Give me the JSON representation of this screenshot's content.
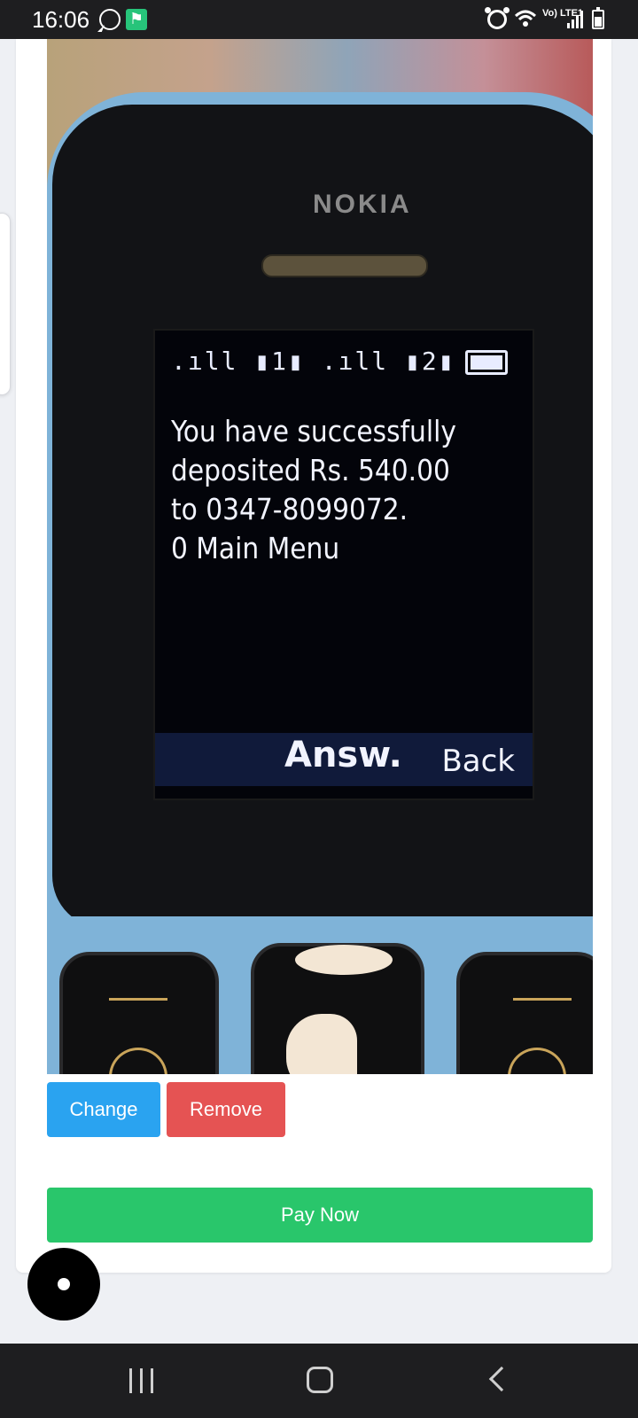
{
  "status_bar": {
    "time": "16:06",
    "network_label": "Vo) LTE1",
    "icons": [
      "whatsapp-icon",
      "fitness-icon",
      "alarm-icon",
      "wifi-icon",
      "signal-icon",
      "battery-icon"
    ]
  },
  "photo": {
    "brand": "NOKIA",
    "screen_indicators": ".ıll ▮1▮ .ıll ▮2▮ ▬",
    "message_lines": [
      "You have successfully",
      "deposited Rs. 540.00",
      "to 0347-8099072.",
      "0 Main Menu"
    ],
    "softkey_center": "Answ.",
    "softkey_right": "Back"
  },
  "actions": {
    "change_label": "Change",
    "remove_label": "Remove",
    "pay_label": "Pay Now"
  },
  "colors": {
    "change": "#2aa3f0",
    "remove": "#e55353",
    "pay": "#29c66b"
  },
  "nav": {
    "icons": [
      "recents-icon",
      "home-icon",
      "back-icon"
    ]
  }
}
